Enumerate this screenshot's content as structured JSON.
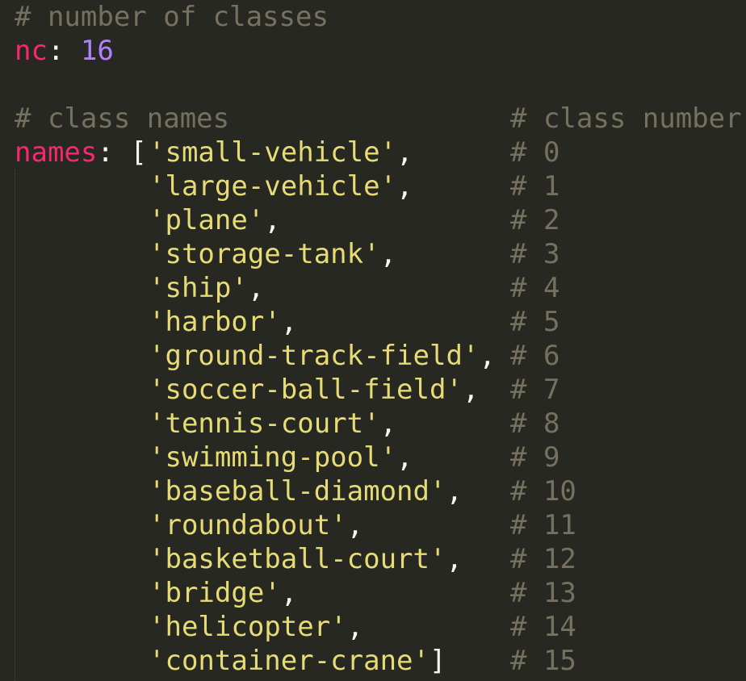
{
  "lines": {
    "comment_nc": "# number of classes",
    "nc_key": "nc",
    "colon": ":",
    "nc_value": "16",
    "comment_names": "# class names",
    "comment_number": "# class number",
    "names_key": "names",
    "open_bracket": "[",
    "close_bracket": "]"
  },
  "classes": [
    {
      "name": "'small-vehicle'",
      "sep": ",",
      "num": "# 0"
    },
    {
      "name": "'large-vehicle'",
      "sep": ",",
      "num": "# 1"
    },
    {
      "name": "'plane'",
      "sep": ",",
      "num": "# 2"
    },
    {
      "name": "'storage-tank'",
      "sep": ",",
      "num": "# 3"
    },
    {
      "name": "'ship'",
      "sep": ",",
      "num": "# 4"
    },
    {
      "name": "'harbor'",
      "sep": ",",
      "num": "# 5"
    },
    {
      "name": "'ground-track-field'",
      "sep": ",",
      "num": "# 6"
    },
    {
      "name": "'soccer-ball-field'",
      "sep": ",",
      "num": "# 7"
    },
    {
      "name": "'tennis-court'",
      "sep": ",",
      "num": "# 8"
    },
    {
      "name": "'swimming-pool'",
      "sep": ",",
      "num": "# 9"
    },
    {
      "name": "'baseball-diamond'",
      "sep": ",",
      "num": "# 10"
    },
    {
      "name": "'roundabout'",
      "sep": ",",
      "num": "# 11"
    },
    {
      "name": "'basketball-court'",
      "sep": ",",
      "num": "# 12"
    },
    {
      "name": "'bridge'",
      "sep": ",",
      "num": "# 13"
    },
    {
      "name": "'helicopter'",
      "sep": ",",
      "num": "# 14"
    },
    {
      "name": "'container-crane'",
      "sep": "",
      "num": "# 15"
    }
  ],
  "colors": {
    "background": "#272822",
    "comment": "#75715e",
    "keyword": "#f92672",
    "number": "#ae81ff",
    "string": "#e6db74",
    "text": "#f8f8f2"
  }
}
